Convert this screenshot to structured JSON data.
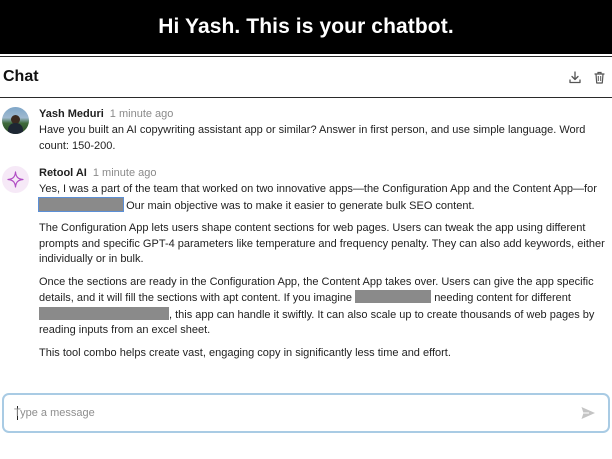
{
  "banner": {
    "title": "Hi Yash. This is your chatbot."
  },
  "chat": {
    "title": "Chat",
    "actions": {
      "download_icon": "download-icon",
      "delete_icon": "trash-icon"
    }
  },
  "messages": [
    {
      "sender": "Yash Meduri",
      "time": "1 minute ago",
      "paragraphs": [
        "Have you built an AI copywriting assistant app or similar? Answer in first person, and use simple language. Word count: 150-200."
      ]
    },
    {
      "sender": "Retool AI",
      "time": "1 minute ago",
      "p1_a": "Yes, I was a part of the team that worked on two innovative apps—the Configuration App and the Content App—for",
      "p1_b": "Our main objective was to make it easier to generate bulk SEO content.",
      "p2": "The Configuration App lets users shape content sections for web pages. Users can tweak the app using different prompts and specific GPT-4 parameters like temperature and frequency penalty. They can also add keywords, either individually or in bulk.",
      "p3_a": "Once the sections are ready in the Configuration App, the Content App takes over. Users can give the app specific details, and it will fill the sections with apt content. If you imagine",
      "p3_b": "needing content for different",
      "p3_c": ", this app can handle it swiftly. It can also scale up to create thousands of web pages by reading inputs from an excel sheet.",
      "p4": "This tool combo helps create vast, engaging copy in significantly less time and effort."
    }
  ],
  "input": {
    "placeholder": "Type a message",
    "value": ""
  },
  "colors": {
    "banner_bg": "#000000",
    "input_border": "#a9cbe4",
    "bot_avatar_bg": "#f6e9f7",
    "sparkle": "#b14ec4"
  }
}
